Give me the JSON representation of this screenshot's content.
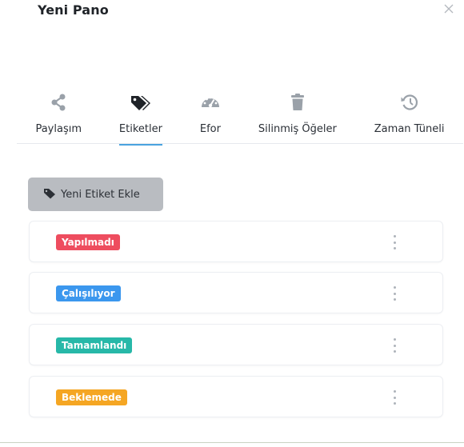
{
  "modal": {
    "title": "Yeni Pano"
  },
  "tabs": [
    {
      "label": "Paylaşım",
      "icon": "share-icon",
      "active": false
    },
    {
      "label": "Etiketler",
      "icon": "tags-icon",
      "active": true
    },
    {
      "label": "Efor",
      "icon": "gauge-icon",
      "active": false
    },
    {
      "label": "Silinmiş Öğeler",
      "icon": "trash-icon",
      "active": false
    },
    {
      "label": "Zaman Tüneli",
      "icon": "history-icon",
      "active": false
    }
  ],
  "add_button": {
    "label": "Yeni Etiket Ekle",
    "icon": "tag-icon"
  },
  "tags": [
    {
      "label": "Yapılmadı",
      "color": "#ee4d5f"
    },
    {
      "label": "Çalışılıyor",
      "color": "#3b97ee"
    },
    {
      "label": "Tamamlandı",
      "color": "#27b8a8"
    },
    {
      "label": "Beklemede",
      "color": "#f5a623"
    }
  ],
  "colors": {
    "accent": "#4aa3df",
    "icon": "#9aa1a9",
    "icon_active": "#1f2328"
  }
}
